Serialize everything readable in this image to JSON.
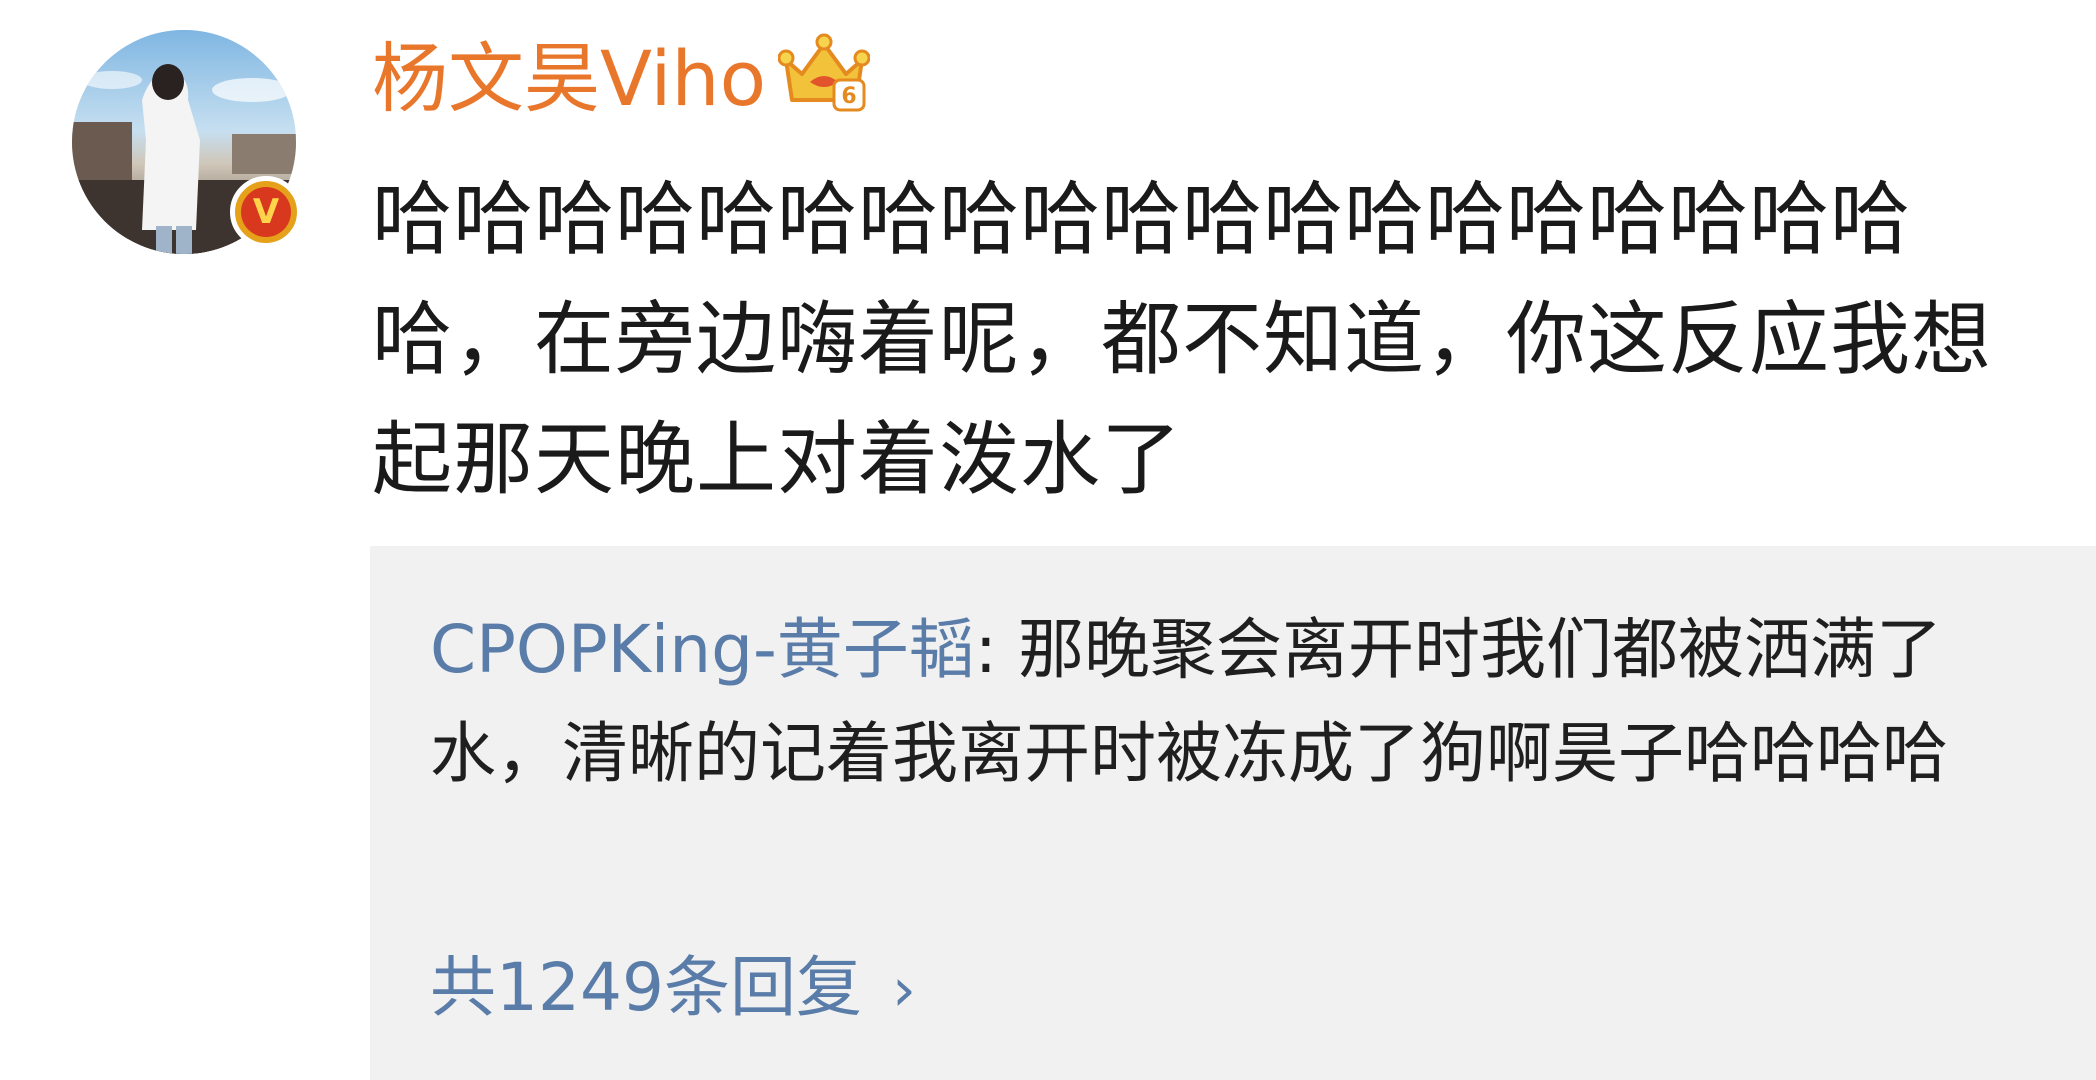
{
  "post": {
    "username": "杨文昊Viho",
    "text": "哈哈哈哈哈哈哈哈哈哈哈哈哈哈哈哈哈哈哈哈，在旁边嗨着呢，都不知道，你这反应我想起那天晚上对着泼水了"
  },
  "quote": {
    "author": "CPOPKing-黄子韬",
    "separator": ": ",
    "text": "那晚聚会离开时我们都被洒满了水，清晰的记着我离开时被冻成了狗啊昊子哈哈哈哈"
  },
  "replies": {
    "label": "共1249条回复",
    "chevron": "›"
  },
  "icons": {
    "avatar": "user-avatar-photo",
    "verified": "verified-v-badge",
    "crown": "crown-member-icon"
  },
  "colors": {
    "username": "#e9772b",
    "link": "#5a7ca8",
    "quote_bg": "#f1f1f1",
    "text": "#1a1a1a"
  }
}
